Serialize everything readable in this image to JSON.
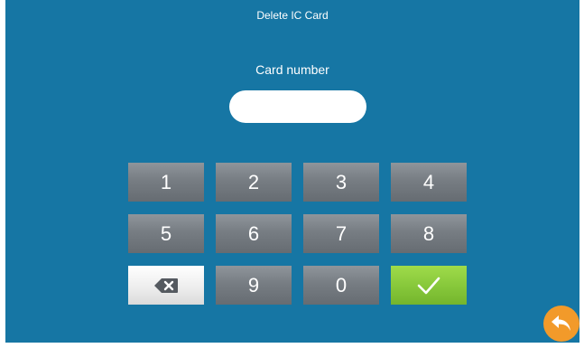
{
  "header": {
    "title": "Delete IC Card"
  },
  "form": {
    "label": "Card number",
    "value": ""
  },
  "keypad": {
    "keys": [
      "1",
      "2",
      "3",
      "4",
      "5",
      "6",
      "7",
      "8",
      "9",
      "0"
    ]
  },
  "icons": {
    "backspace": "backspace-icon",
    "confirm": "checkmark-icon",
    "back": "return-arrow-icon"
  },
  "colors": {
    "background": "#1676a4",
    "key": "#777d83",
    "confirm": "#86c73a",
    "back": "#f29a2a"
  }
}
